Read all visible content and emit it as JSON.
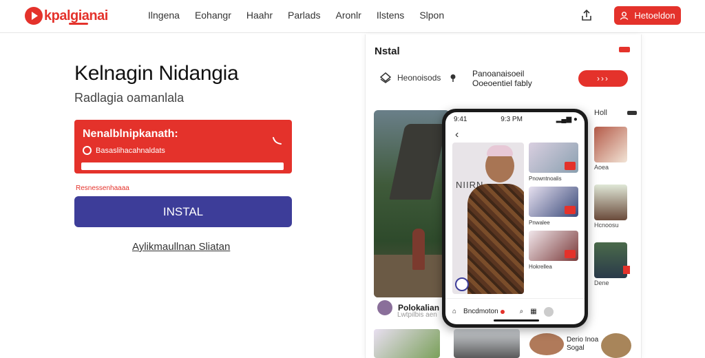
{
  "header": {
    "logo_text": "kpalgianai",
    "nav": [
      "Ilngena",
      "Eohangr",
      "Haahr",
      "Parlads",
      "Aronlr",
      "Ilstens",
      "Slpon"
    ],
    "action_label": "Hetoeldon"
  },
  "hero": {
    "title": "Kelnagin Nidangia",
    "subtitle": "Radlagia oamanlala",
    "card_title": "Nenalblnipkanath:",
    "card_row": "Basaslihacahnaldats",
    "small_red": "Resnessenhaaaa",
    "install_label": "INSTAL",
    "link_text": "Aylikmaullnan Sliatan"
  },
  "panel": {
    "title": "Nstal",
    "row_text": "Heonoisods",
    "desc_line1": "Panoanaisoeil",
    "desc_line2": "Ooeoentiel fably",
    "pill": "›››",
    "author_name": "Polokalian",
    "author_sub": "Lwtpilbis aen",
    "right_col": {
      "header": "Holl",
      "captions": [
        "Aoea",
        "Hcnoosu",
        "Dene"
      ]
    }
  },
  "phone": {
    "time_left": "9:41",
    "time_center": "9:3 PM",
    "wall_text": "NIIRN",
    "captions": [
      "Pnowntnoalis",
      "Pnwalee",
      "Hokrellea"
    ],
    "nav_label": "Bncdmoton"
  },
  "bottom": {
    "caption": "Derio Inoa",
    "caption2": "Sogal"
  },
  "colors": {
    "brand_red": "#e4322b",
    "install_blue": "#3d3d99"
  },
  "icons": [
    "play-logo-icon",
    "share-icon",
    "user-icon",
    "phone-icon",
    "layers-icon",
    "pin-icon",
    "back-arrow-icon",
    "verify-badge-icon",
    "home-icon",
    "search-icon"
  ]
}
